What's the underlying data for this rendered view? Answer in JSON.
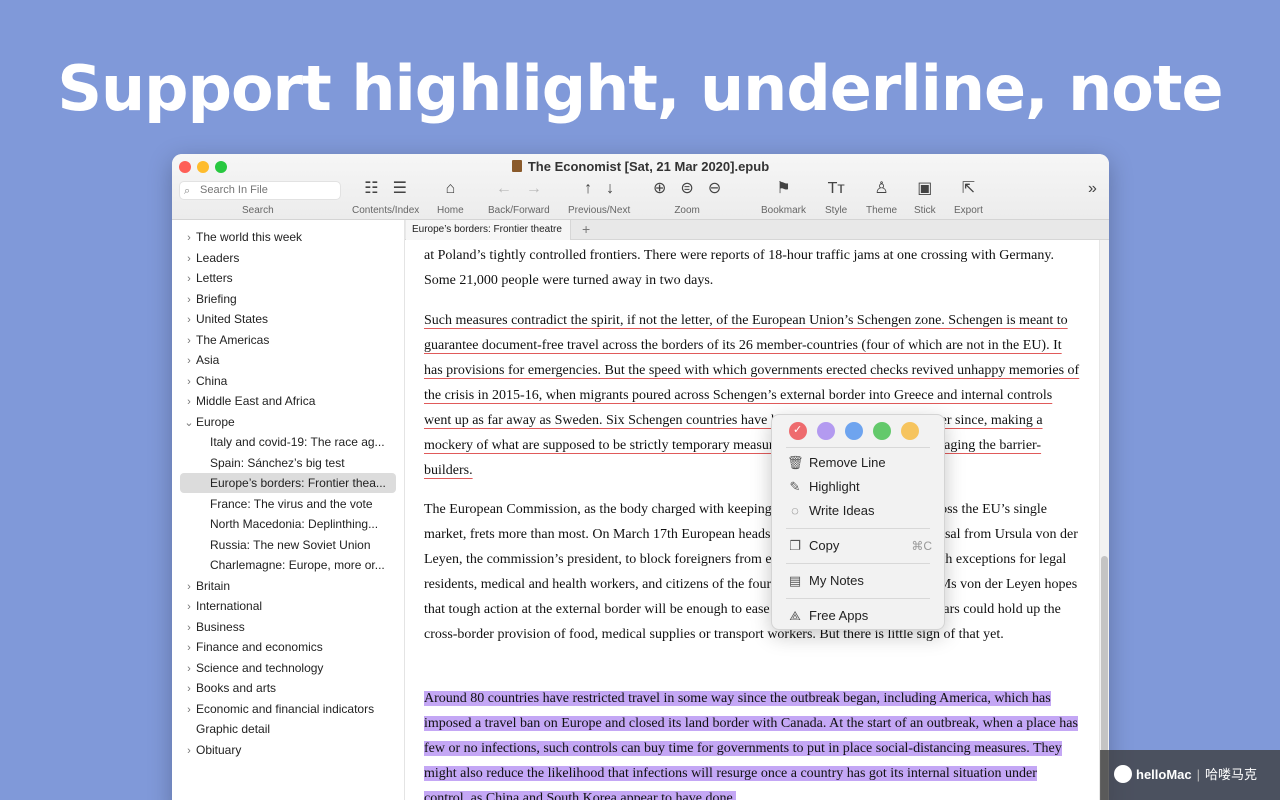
{
  "headline": "Support highlight, underline, note",
  "window": {
    "title": "The Economist [Sat, 21 Mar 2020].epub"
  },
  "toolbar": {
    "search_placeholder": "Search In File",
    "search_label": "Search",
    "contents_label": "Contents/Index",
    "home_label": "Home",
    "backforward_label": "Back/Forward",
    "prevnext_label": "Previous/Next",
    "zoom_label": "Zoom",
    "bookmark_label": "Bookmark",
    "style_label": "Style",
    "theme_label": "Theme",
    "stick_label": "Stick",
    "export_label": "Export"
  },
  "sidebar": {
    "items": [
      {
        "label": "The world this week"
      },
      {
        "label": "Leaders"
      },
      {
        "label": "Letters"
      },
      {
        "label": "Briefing"
      },
      {
        "label": "United States"
      },
      {
        "label": "The Americas"
      },
      {
        "label": "Asia"
      },
      {
        "label": "China"
      },
      {
        "label": "Middle East and Africa"
      },
      {
        "label": "Europe"
      },
      {
        "label": "Italy and covid-19: The race ag..."
      },
      {
        "label": "Spain: Sánchez’s big test"
      },
      {
        "label": "Europe’s borders: Frontier thea..."
      },
      {
        "label": "France: The virus and the vote"
      },
      {
        "label": "North Macedonia: Deplinthing..."
      },
      {
        "label": "Russia: The new Soviet Union"
      },
      {
        "label": "Charlemagne: Europe, more or..."
      },
      {
        "label": "Britain"
      },
      {
        "label": "International"
      },
      {
        "label": "Business"
      },
      {
        "label": "Finance and economics"
      },
      {
        "label": "Science and technology"
      },
      {
        "label": "Books and arts"
      },
      {
        "label": "Economic and financial indicators"
      },
      {
        "label": "Graphic detail"
      },
      {
        "label": "Obituary"
      }
    ]
  },
  "tabs": {
    "active": "Europe’s borders: Frontier theatre",
    "add": "+"
  },
  "article": {
    "p1": "at Poland’s tightly controlled frontiers. There were reports of 18-hour traffic jams at one crossing with Germany. Some 21,000 people were turned away in two days.",
    "p2": "Such measures contradict the spirit, if not the letter, of the European Union’s Schengen zone. Schengen is meant to guarantee document-free travel across the borders of its 26 member-countries (four of which are not in the EU). It has provisions for emergencies. But the speed with which governments erected checks revived unhappy memories of the crisis in 2015-16, when migrants poured across Schengen’s external border into Greece and internal controls went up as far away as Sweden. Six Schengen countries have kept some controls in place ever since, making a mockery of what are supposed to be strictly temporary measures. Fears of the virus is encouraging the barrier-builders.",
    "p3": "The European Commission, as the body charged with keeping goods and people moving across the EU’s single market, frets more than most. On March 17th European heads of government backed a proposal from Ursula von der Leyen, the commission’s president, to block foreigners from entering the EU for 30 days, with exceptions for legal residents, medical and health workers, and citizens of the four non-EU Schengen members. Ms von der Leyen hopes that tough action at the external border will be enough to ease the internal ones, which she fears could hold up the cross-border provision of food, medical supplies or transport workers. But there is little sign of that yet.",
    "p4": "Around 80 countries have restricted travel in some way since the outbreak began, including America, which has imposed a travel ban on Europe and closed its land border with Canada. At the start of an outbreak, when a place has few or no infections, such controls can buy time for governments to put in place social-distancing measures. They might also reduce the likelihood that infections will resurge once a country has got its internal situation under control, as China and South Korea appear to have done."
  },
  "popup": {
    "swatch_colors": [
      "#ee6b6e",
      "#b39af0",
      "#6ea4ef",
      "#63c96b",
      "#f6c45e"
    ],
    "remove_line": "Remove Line",
    "highlight": "Highlight",
    "write_ideas": "Write Ideas",
    "copy": "Copy",
    "copy_shortcut": "⌘C",
    "my_notes": "My Notes",
    "free_apps": "Free Apps"
  },
  "watermark": {
    "brand": "helloMac",
    "cn": "哈喽马克"
  },
  "colors": {
    "background": "#8099d9",
    "underline": "#e05a5a",
    "highlight": "#c4a7f5"
  }
}
